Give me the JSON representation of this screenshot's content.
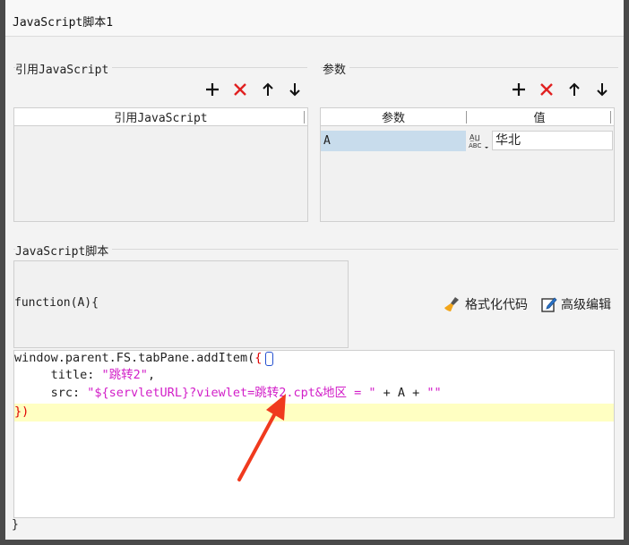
{
  "window": {
    "title": "JavaScript脚本1"
  },
  "refs": {
    "group_title": "引用JavaScript",
    "column_header": "引用JavaScript",
    "rows": []
  },
  "params": {
    "group_title": "参数",
    "columns": [
      "参数",
      "值"
    ],
    "rows": [
      {
        "name": "A",
        "type_icon": "abc-type-icon",
        "value": "华北"
      }
    ]
  },
  "toolbar_icons": [
    "plus-icon",
    "delete-x-icon",
    "arrow-up-icon",
    "arrow-down-icon"
  ],
  "script": {
    "group_title": "JavaScript脚本",
    "function_header": "function(A){",
    "format_button": "格式化代码",
    "advanced_button": "高级编辑",
    "closing": "}",
    "code": {
      "line1": "window.parent.FS.tabPane.addItem(",
      "line1_brace": "{",
      "line2_key": "     title: ",
      "line2_val": "\"跳转2\"",
      "line2_end": ",",
      "line3_key": "     src: ",
      "line3_val": "\"${servletURL}?viewlet=跳转2.cpt&地区 = \"",
      "line3_plus1": " + A + ",
      "line3_val2": "\"\"",
      "line4": "})"
    }
  },
  "colors": {
    "accent_red": "#e02020",
    "string": "#d21ec8",
    "highlight_line": "#ffffc2",
    "selected_row": "#c8dcec"
  }
}
